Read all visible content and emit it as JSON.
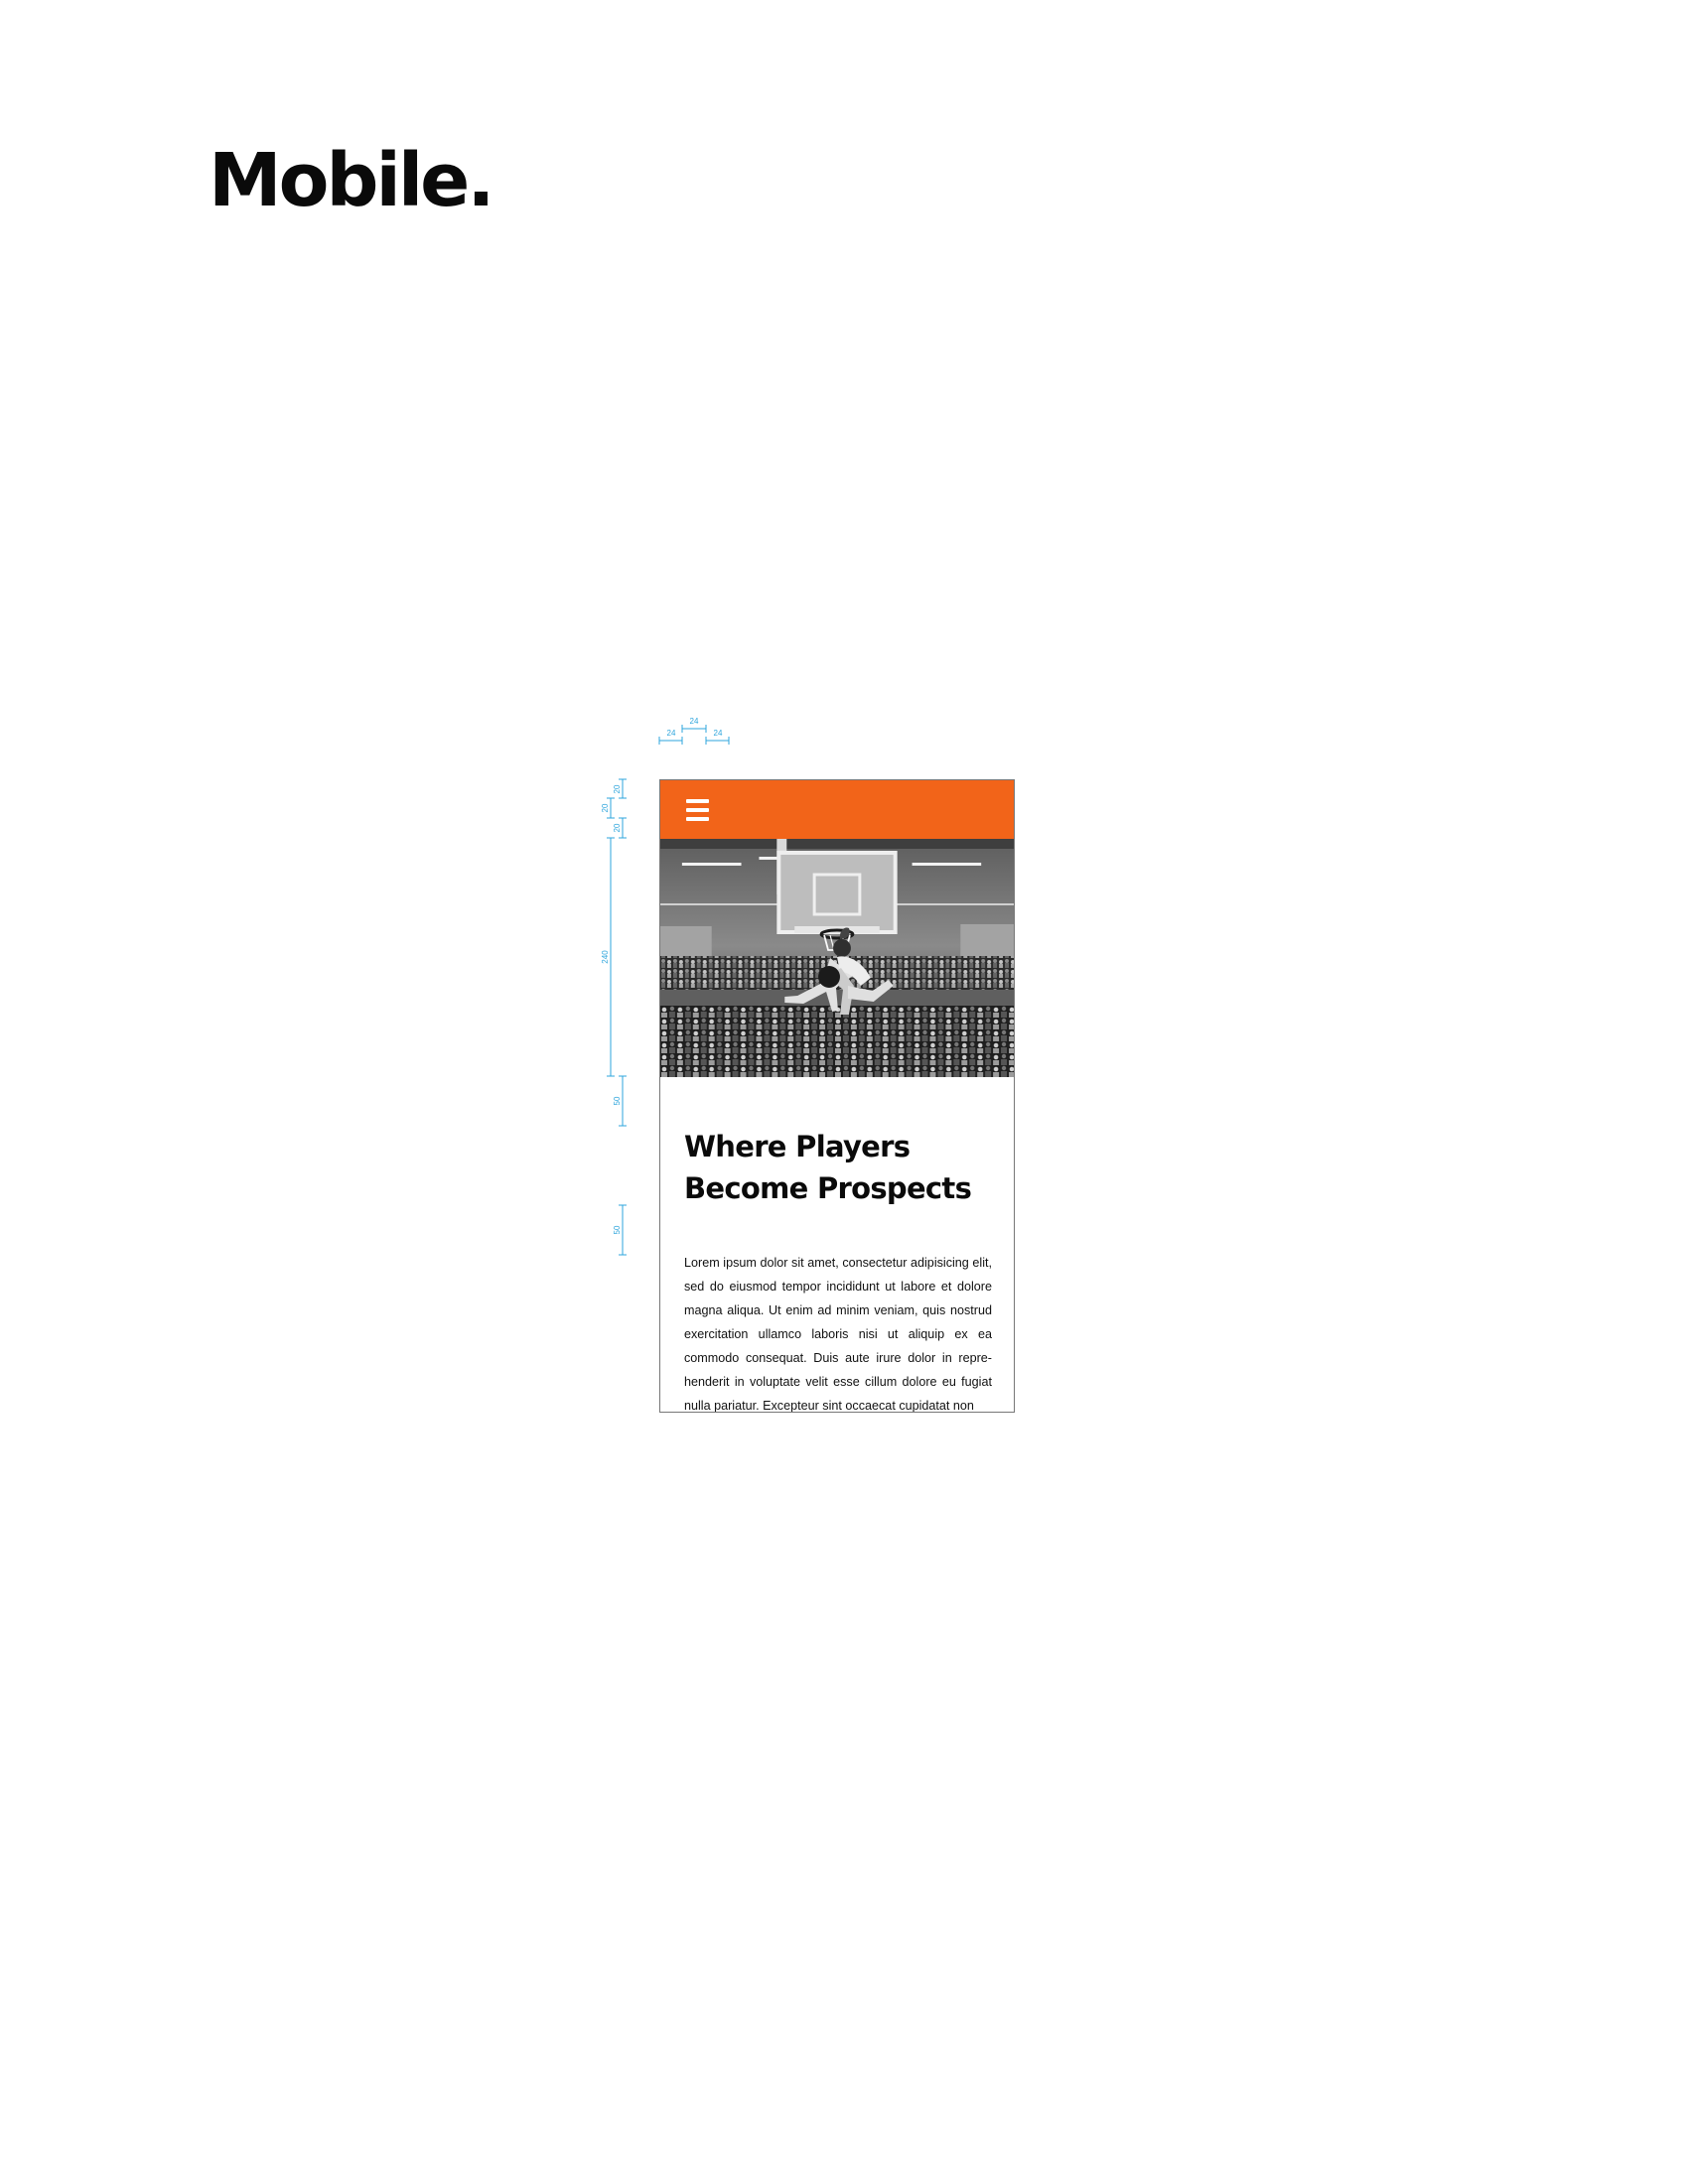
{
  "page": {
    "heading": "Mobile."
  },
  "annotations": {
    "spacing_labels": [
      "24",
      "24",
      "24"
    ],
    "vertical_labels": [
      "20",
      "20",
      "20",
      "240",
      "50",
      "50"
    ],
    "color": "#2ea5dc"
  },
  "mobile": {
    "header": {
      "background_color": "#f26419",
      "menu_icon": "hamburger-menu-icon"
    },
    "hero_image": {
      "description_icon": "basketball-dunk-photo",
      "style": "grayscale"
    },
    "hero_title": "Where Players Become Prospects",
    "body_text": "Lorem ipsum dolor sit amet, consectetur adipisicing elit, sed do eiusmod tempor incididunt ut labore et dolore magna aliqua. Ut enim ad minim veniam, quis nostrud exercitation ullamco laboris nisi ut aliquip ex ea commodo consequat. Duis aute irure dolor in repre-henderit in voluptate velit esse cillum dolore eu fugiat nulla pariatur. Excepteur sint occaecat cupidatat non"
  }
}
